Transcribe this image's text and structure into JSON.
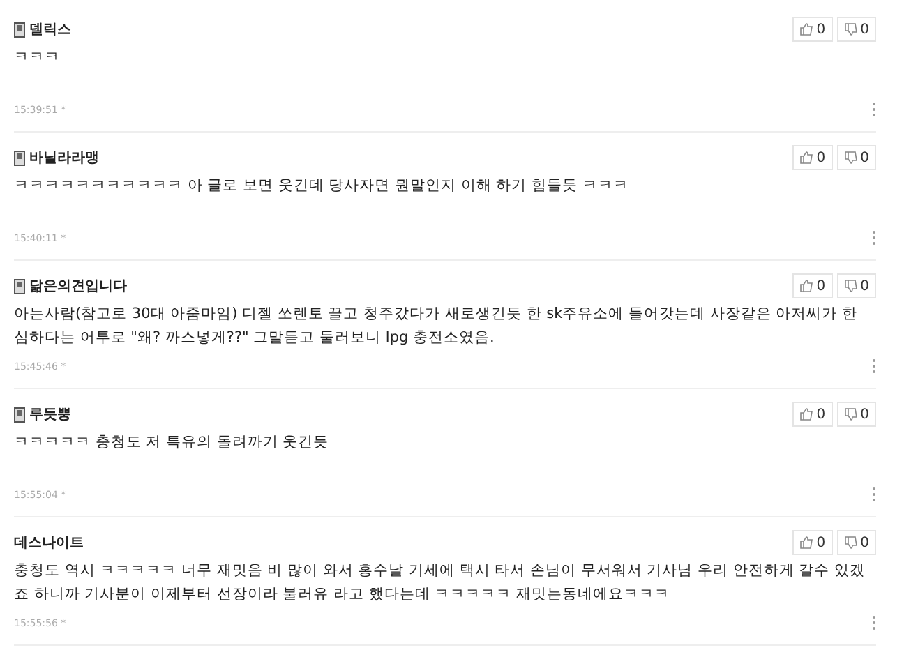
{
  "comments": [
    {
      "author": "델릭스",
      "member_icon": true,
      "text": "ㅋㅋㅋ",
      "time": "15:39:51 *",
      "likes": "0",
      "dislikes": "0"
    },
    {
      "author": "바닐라라맹",
      "member_icon": true,
      "text": "ㅋㅋㅋㅋㅋㅋㅋㅋㅋㅋㅋ 아 글로 보면 웃긴데 당사자면 뭔말인지 이해 하기 힘들듯 ㅋㅋㅋ",
      "time": "15:40:11 *",
      "likes": "0",
      "dislikes": "0"
    },
    {
      "author": "닮은의견입니다",
      "member_icon": true,
      "text": "아는사람(참고로 30대 아줌마임)  디젤 쏘렌토 끌고  청주갔다가 새로생긴듯 한 sk주유소에 들어갓는데  사장같은 아저씨가  한심하다는 어투로  \"왜?  까스넣게??\"  그말듣고   둘러보니  lpg 충전소였음.",
      "time": "15:45:46 *",
      "likes": "0",
      "dislikes": "0"
    },
    {
      "author": "루듯뿡",
      "member_icon": true,
      "text": "ㅋㅋㅋㅋㅋ 충청도 저 특유의 돌려까기 웃긴듯",
      "time": "15:55:04 *",
      "likes": "0",
      "dislikes": "0"
    },
    {
      "author": "데스나이트",
      "member_icon": false,
      "text": "충청도 역시 ㅋㅋㅋㅋㅋ 너무 재밋음 비 많이 와서 홍수날 기세에 택시 타서 손님이 무서워서 기사님 우리 안전하게 갈수 있겠죠 하니까 기사분이 이제부터 선장이라 불러유 라고 했다는데 ㅋㅋㅋㅋㅋ 재밋는동네에요ㅋㅋㅋ",
      "time": "15:55:56 *",
      "likes": "0",
      "dislikes": "0"
    }
  ]
}
